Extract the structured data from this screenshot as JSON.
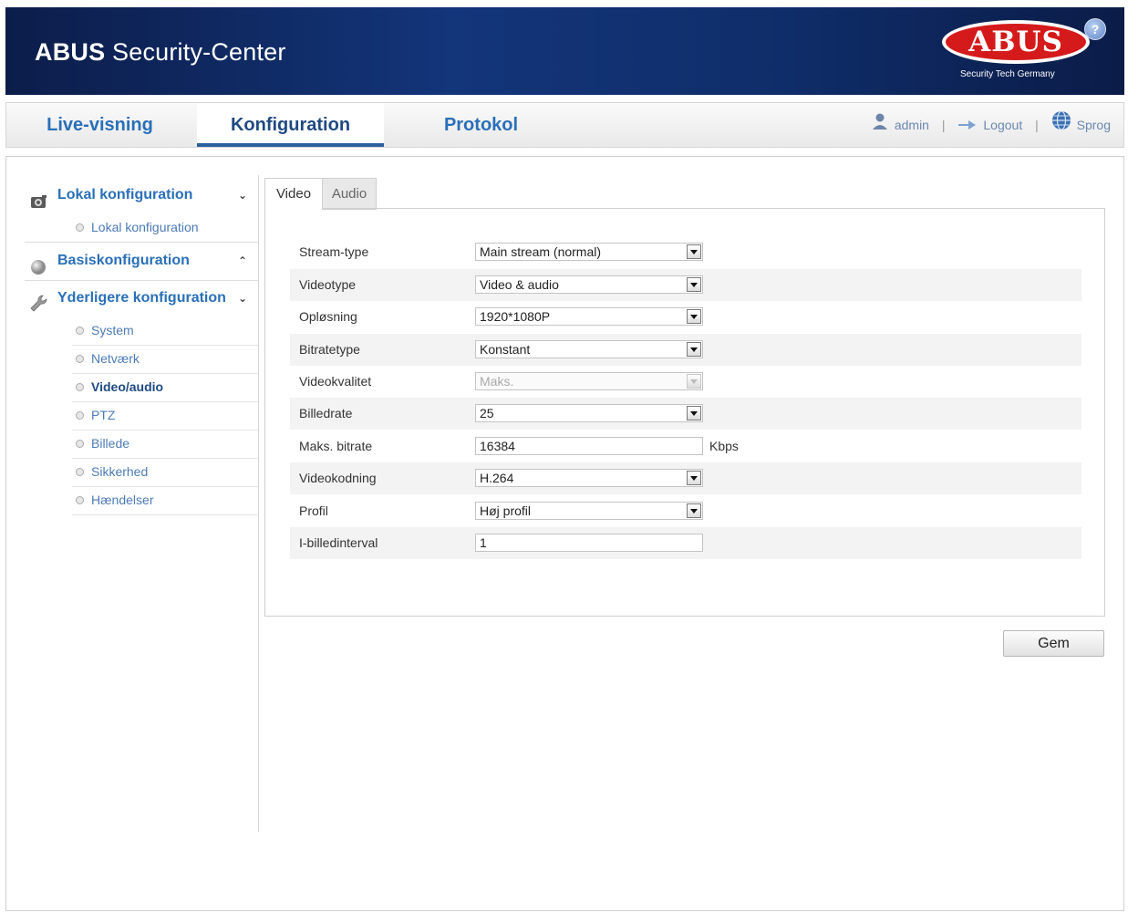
{
  "header": {
    "title_brand": "ABUS",
    "title_rest": "Security-Center",
    "logo_text": "ABUS",
    "logo_tagline": "Security Tech Germany",
    "help_symbol": "?"
  },
  "nav": {
    "tabs": [
      {
        "label": "Live-visning"
      },
      {
        "label": "Konfiguration"
      },
      {
        "label": "Protokol"
      }
    ],
    "active_tab": "Konfiguration",
    "user": "admin",
    "logout": "Logout",
    "language": "Sprog",
    "separator": "|"
  },
  "sidebar": {
    "sections": [
      {
        "label": "Lokal konfiguration",
        "icon": "camera-icon",
        "expanded": true
      },
      {
        "label": "Basiskonfiguration",
        "icon": "sphere-icon",
        "expanded": false
      },
      {
        "label": "Yderligere konfiguration",
        "icon": "wrench-icon",
        "expanded": true
      }
    ],
    "local_items": [
      "Lokal konfiguration"
    ],
    "advanced_items": [
      "System",
      "Netværk",
      "Video/audio",
      "PTZ",
      "Billede",
      "Sikkerhed",
      "Hændelser"
    ],
    "active_item": "Video/audio"
  },
  "tabs": {
    "video": "Video",
    "audio": "Audio",
    "active": "Video"
  },
  "form": {
    "stream_type": {
      "label": "Stream-type",
      "value": "Main stream (normal)"
    },
    "video_type": {
      "label": "Videotype",
      "value": "Video & audio"
    },
    "resolution": {
      "label": "Opløsning",
      "value": "1920*1080P"
    },
    "bitrate_type": {
      "label": "Bitratetype",
      "value": "Konstant"
    },
    "video_quality": {
      "label": "Videokvalitet",
      "value": "Maks.",
      "disabled": true
    },
    "frame_rate": {
      "label": "Billedrate",
      "value": "25"
    },
    "max_bitrate": {
      "label": "Maks. bitrate",
      "value": "16384",
      "unit": "Kbps"
    },
    "video_encoding": {
      "label": "Videokodning",
      "value": "H.264"
    },
    "profile": {
      "label": "Profil",
      "value": "Høj profil"
    },
    "i_frame_interval": {
      "label": "I-billedinterval",
      "value": "1"
    }
  },
  "save_label": "Gem",
  "colors": {
    "header_bg": "#13357a",
    "brand_red": "#d41a1a",
    "link_blue": "#2a6fb8",
    "active_blue": "#1f4a82"
  }
}
